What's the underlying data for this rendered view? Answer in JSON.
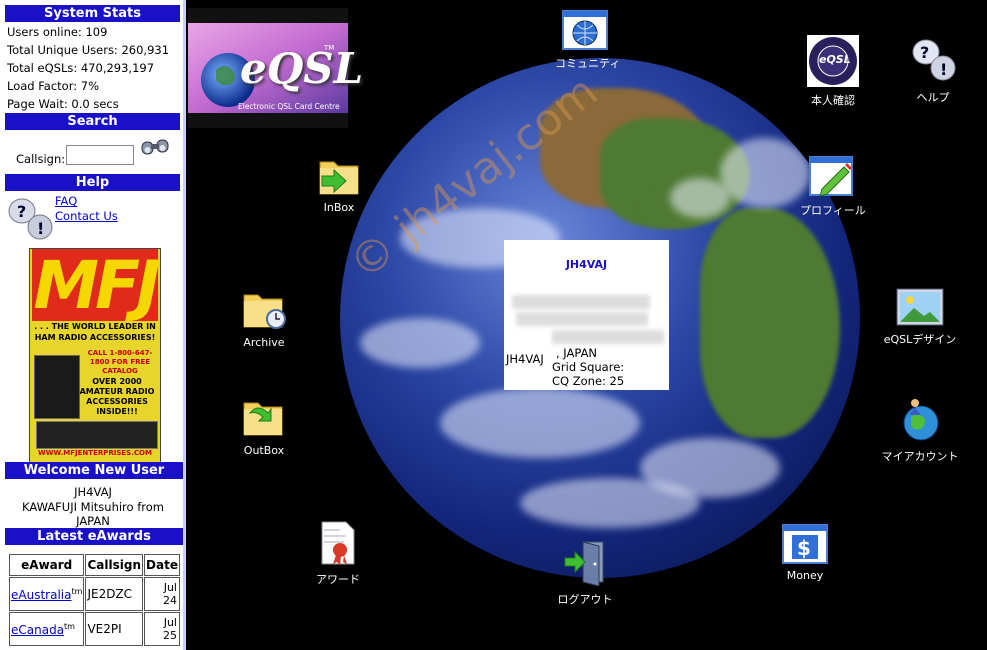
{
  "sidebar": {
    "system_stats": {
      "heading": "System Stats",
      "lines": [
        "Users online: 109",
        "Total Unique Users: 260,931",
        "Total eQSLs: 470,293,197",
        "Load Factor: 7%",
        "Page Wait: 0.0 secs"
      ]
    },
    "search": {
      "heading": "Search",
      "label": "Callsign:",
      "value": ""
    },
    "help": {
      "heading": "Help",
      "faq": "FAQ",
      "contact": "Contact Us"
    },
    "ad": {
      "logo": "MFJ",
      "line1": ". . . THE WORLD LEADER IN HAM RADIO ACCESSORIES!",
      "line2": "CALL 1-800-647-1800 FOR FREE CATALOG",
      "line3": "OVER 2000 AMATEUR RADIO ACCESSORIES INSIDE!!!",
      "url": "WWW.MFJENTERPRISES.COM"
    },
    "welcome": {
      "heading": "Welcome New User",
      "lines": [
        "JH4VAJ",
        "KAWAFUJI Mitsuhiro from",
        "JAPAN"
      ]
    },
    "awards": {
      "heading": "Latest eAwards",
      "columns": [
        "eAward",
        "Callsign",
        "Date"
      ],
      "rows": [
        {
          "award": "eAustralia",
          "tm": "tm",
          "callsign": "JE2DZC",
          "date_month": "Jul",
          "date_day": "24"
        },
        {
          "award": "eCanada",
          "tm": "tm",
          "callsign": "VE2PI",
          "date_month": "Jul",
          "date_day": "25"
        }
      ]
    }
  },
  "banner": {
    "logo": "eQSL",
    "tm": "TM",
    "caption": "Electronic QSL Card Centre"
  },
  "desktop_icons": {
    "community": "コミュニティ",
    "verify": "本人確認",
    "help": "ヘルプ",
    "inbox": "InBox",
    "profile": "プロフィール",
    "archive": "Archive",
    "eqsl_design": "eQSLデザイン",
    "outbox": "OutBox",
    "my_account": "マイアカウント",
    "award": "アワード",
    "logout": "ログアウト",
    "money": "Money",
    "verify_badge": "eQSL",
    "verify_ring": "Authenticity Guaranteed"
  },
  "popup": {
    "callsign": "JH4VAJ",
    "name_prefix": "JH4VAJ",
    "country": ", JAPAN",
    "grid": "Grid Square:",
    "cq_zone": "CQ Zone: 25"
  },
  "watermark": "© jh4vaj.com",
  "colors": {
    "header_blue": "#1a10c8",
    "link_blue": "#0000cc",
    "desktop_bg": "#000000"
  }
}
